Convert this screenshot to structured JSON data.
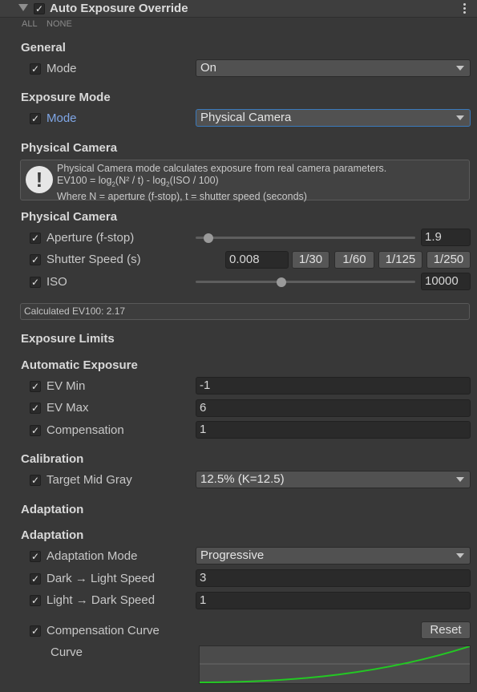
{
  "header": {
    "title": "Auto Exposure Override",
    "enabled": true,
    "menu_icon": "kebab-menu-icon"
  },
  "toggles": {
    "all": "ALL",
    "none": "NONE"
  },
  "general": {
    "title": "General",
    "mode_label": "Mode",
    "mode_value": "On"
  },
  "exposure_mode": {
    "title": "Exposure Mode",
    "mode_label": "Mode",
    "mode_value": "Physical Camera"
  },
  "physical_camera_info": {
    "title": "Physical Camera",
    "icon": "info-icon",
    "line1": "Physical Camera mode calculates exposure from real camera parameters.",
    "line2_prefix": "EV100 = log",
    "line2_sub1": "2",
    "line2_mid": "(N² / t) - log",
    "line2_sub2": "2",
    "line2_suffix": "(ISO / 100)",
    "line3": "Where N = aperture (f-stop), t = shutter speed (seconds)"
  },
  "physical_camera": {
    "title": "Physical Camera",
    "aperture": {
      "label": "Aperture (f-stop)",
      "value": "1.9",
      "slider_fraction": 0.06
    },
    "shutter": {
      "label": "Shutter Speed (s)",
      "value": "0.008",
      "presets": [
        "1/30",
        "1/60",
        "1/125",
        "1/250"
      ]
    },
    "iso": {
      "label": "ISO",
      "value": "10000",
      "slider_fraction": 0.39
    },
    "calculated": "Calculated EV100: 2.17"
  },
  "exposure_limits": {
    "title": "Exposure Limits"
  },
  "automatic_exposure": {
    "title": "Automatic Exposure",
    "ev_min": {
      "label": "EV Min",
      "value": "-1"
    },
    "ev_max": {
      "label": "EV Max",
      "value": "6"
    },
    "compensation": {
      "label": "Compensation",
      "value": "1"
    }
  },
  "calibration": {
    "title": "Calibration",
    "target_label": "Target Mid Gray",
    "target_value": "12.5% (K=12.5)"
  },
  "adaptation_header": {
    "title": "Adaptation"
  },
  "adaptation": {
    "title": "Adaptation",
    "mode": {
      "label": "Adaptation Mode",
      "value": "Progressive"
    },
    "dark_to_light": {
      "label": "Dark → Light Speed",
      "value": "3"
    },
    "light_to_dark": {
      "label": "Light → Dark Speed",
      "value": "1"
    },
    "curve": {
      "label": "Compensation Curve",
      "reset": "Reset",
      "curve_label": "Curve",
      "curve_color": "#23c823"
    }
  }
}
